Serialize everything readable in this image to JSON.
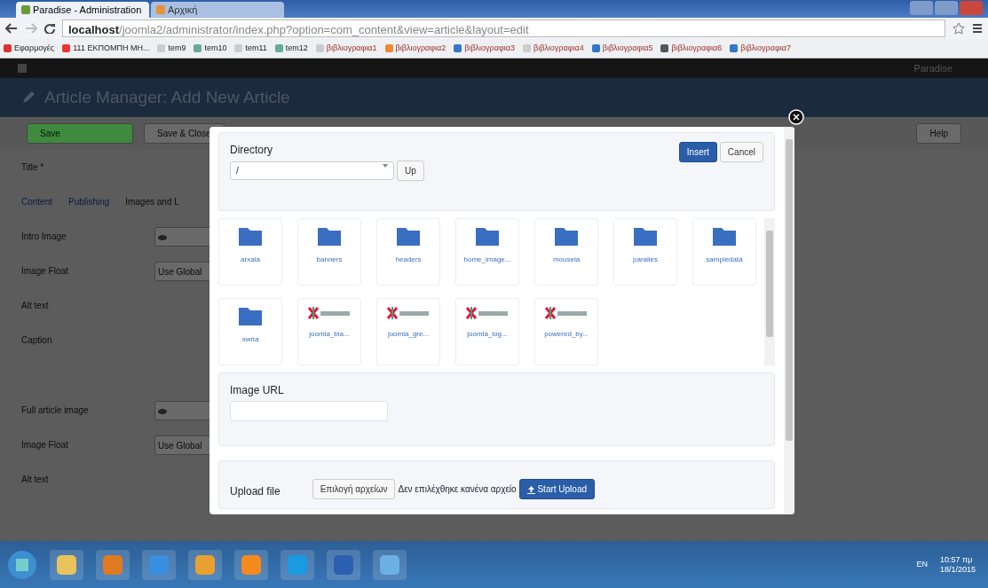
{
  "browser": {
    "tabs": [
      {
        "title": "Paradise - Administration",
        "selected": true
      },
      {
        "title": "Αρχική",
        "selected": false
      }
    ],
    "address": {
      "host": "localhost",
      "path": "/joomla2/administrator/index.php?option=com_content&view=article&layout=edit"
    },
    "bookmarks": [
      "Εφαρμογές",
      "111 ΕΚΠΟΜΠΗ ΜΗ...",
      "tem9",
      "tem10",
      "tem11",
      "tem12",
      "βιβλιογραφια1",
      "βιβλιογραφια2",
      "βιβλιογραφια3",
      "βιβλιογραφια4",
      "βιβλιογραφια5",
      "βιβλιογραφια6",
      "βιβλιογραφια7"
    ]
  },
  "admin": {
    "user": "Paradise",
    "page_title": "Article Manager: Add New Article",
    "toolbar": [
      {
        "label": "Save",
        "kind": "primary"
      },
      {
        "label": "Save & Close",
        "kind": "default"
      }
    ],
    "help": "Help",
    "title_label": "Title *",
    "tabs": [
      {
        "label": "Content",
        "selected": false
      },
      {
        "label": "Publishing",
        "selected": false
      },
      {
        "label": "Images and L",
        "selected": true
      }
    ],
    "fields": [
      {
        "label": "Intro Image",
        "kind": "image"
      },
      {
        "label": "Image Float",
        "kind": "select",
        "value": "Use Global"
      },
      {
        "label": "Alt text",
        "kind": "text"
      },
      {
        "label": "Caption",
        "kind": "text"
      },
      {
        "label": "Full article image",
        "kind": "image"
      },
      {
        "label": "Image Float",
        "kind": "select",
        "value": "Use Global"
      },
      {
        "label": "Alt text",
        "kind": "text"
      }
    ]
  },
  "modal": {
    "directory_label": "Directory",
    "directory_value": "/",
    "up": "Up",
    "insert": "Insert",
    "cancel": "Cancel",
    "items": [
      {
        "name": "arxaia",
        "kind": "folder"
      },
      {
        "name": "banners",
        "kind": "folder"
      },
      {
        "name": "headers",
        "kind": "folder"
      },
      {
        "name": "home_image...",
        "kind": "folder"
      },
      {
        "name": "mouseia",
        "kind": "folder"
      },
      {
        "name": "paralies",
        "kind": "folder"
      },
      {
        "name": "sampledata",
        "kind": "folder"
      },
      {
        "name": "xwria",
        "kind": "folder"
      },
      {
        "name": "joomla_bla...",
        "kind": "image"
      },
      {
        "name": "joomla_gre...",
        "kind": "image"
      },
      {
        "name": "joomla_log...",
        "kind": "image"
      },
      {
        "name": "powered_by...",
        "kind": "image"
      }
    ],
    "url_label": "Image URL",
    "upload_label": "Upload file",
    "choose": "Επιλογή αρχείων",
    "no_file": "Δεν επιλέχθηκε κανένα αρχείο",
    "start_upload": "Start Upload"
  },
  "taskbar": {
    "lang": "EN",
    "time": "10:57 πμ",
    "date": "18/1/2015"
  }
}
